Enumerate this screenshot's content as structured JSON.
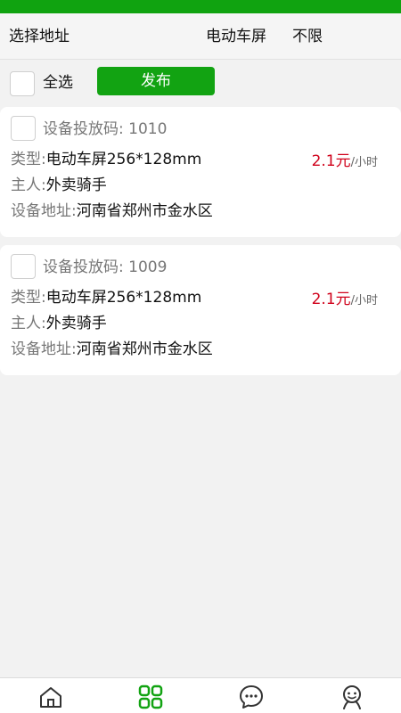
{
  "filter_bar": {
    "address_label": "选择地址",
    "device_type": "电动车屏",
    "limit": "不限"
  },
  "select_bar": {
    "select_all_label": "全选",
    "publish_label": "发布"
  },
  "devices": [
    {
      "code": "设备投放码: 1010",
      "type_label": "类型:",
      "type_value": "电动车屏256*128mm",
      "price": "2.1元",
      "price_unit": "/小时",
      "owner_label": "主人:",
      "owner_value": "外卖骑手",
      "address_label": "设备地址:",
      "address_value": "河南省郑州市金水区"
    },
    {
      "code": "设备投放码: 1009",
      "type_label": "类型:",
      "type_value": "电动车屏256*128mm",
      "price": "2.1元",
      "price_unit": "/小时",
      "owner_label": "主人:",
      "owner_value": "外卖骑手",
      "address_label": "设备地址:",
      "address_value": "河南省郑州市金水区"
    }
  ],
  "bottom_nav": {
    "items": [
      {
        "icon": "home-icon"
      },
      {
        "icon": "grid-icon"
      },
      {
        "icon": "chat-icon"
      },
      {
        "icon": "profile-icon"
      }
    ]
  },
  "colors": {
    "brand_green": "#12a312",
    "price_red": "#d0021b"
  }
}
